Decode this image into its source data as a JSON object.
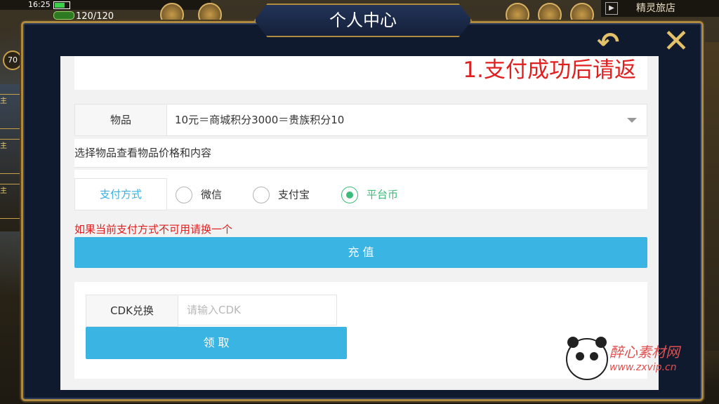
{
  "status": {
    "time": "16:25",
    "energy": "120/120",
    "level": "70"
  },
  "hud": {
    "sprite_inn_label": "精灵旅店",
    "side_tag": "主"
  },
  "dialog": {
    "title": "个人中心"
  },
  "notice": {
    "text": "1.支付成功后请返"
  },
  "item": {
    "label": "物品",
    "selected": "10元＝商城积分3000＝贵族积分10",
    "hint": "选择物品查看物品价格和内容"
  },
  "payment": {
    "label": "支付方式",
    "options": [
      {
        "label": "微信",
        "checked": false
      },
      {
        "label": "支付宝",
        "checked": false
      },
      {
        "label": "平台币",
        "checked": true
      }
    ],
    "warning": "如果当前支付方式不可用请换一个",
    "submit_label": "充 值"
  },
  "cdk": {
    "label": "CDK兑换",
    "placeholder": "请输入CDK",
    "claim_label": "领 取"
  },
  "watermark": {
    "title": "醉心素材网",
    "url": "www.zxvip.cn"
  },
  "colors": {
    "accent_blue": "#3ab4e2",
    "label_blue": "#3ab0e0",
    "radio_green": "#3dbb7a",
    "warning_red": "#e02020",
    "frame_gold": "#b08a3e"
  }
}
